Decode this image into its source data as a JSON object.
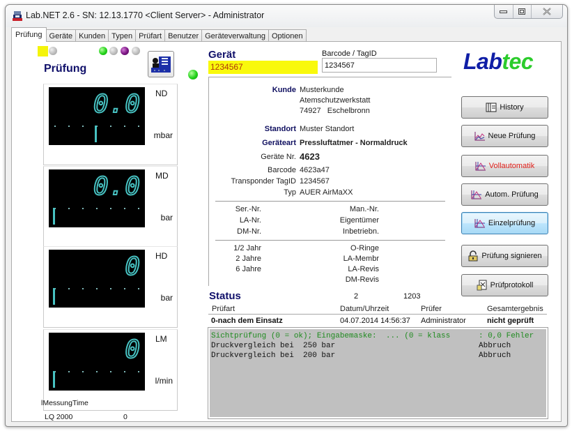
{
  "window": {
    "title": "Lab.NET 2.6 - SN: 12.13.1770 <Client Server> - Administrator",
    "controls": {
      "minimize": "minimize",
      "maximize": "maximize",
      "close": "close"
    }
  },
  "tabs": [
    {
      "label": "Prüfung",
      "active": true
    },
    {
      "label": "Geräte",
      "active": false
    },
    {
      "label": "Kunden",
      "active": false
    },
    {
      "label": "Typen",
      "active": false
    },
    {
      "label": "Prüfart",
      "active": false
    },
    {
      "label": "Benutzer",
      "active": false
    },
    {
      "label": "Geräteverwaltung",
      "active": false
    },
    {
      "label": "Optionen",
      "active": false
    }
  ],
  "left": {
    "heading": "Prüfung",
    "indicators": [
      "yellow",
      "gray",
      "green",
      "gray",
      "purple",
      "gray"
    ],
    "status_led": "green",
    "gauges": [
      {
        "name": "ND",
        "value": "0.0",
        "unit": "mbar",
        "needle_position": 0.5
      },
      {
        "name": "MD",
        "value": "0.0",
        "unit": "bar",
        "needle_position": 0
      },
      {
        "name": "HD",
        "value": "0",
        "unit": "bar",
        "needle_position": 0
      },
      {
        "name": "LM",
        "value": "0",
        "unit": "l/min",
        "needle_position": 0
      }
    ],
    "messung_time_label": "lMessungTime",
    "device_label": "LQ 2000",
    "device_value": "0"
  },
  "geraet": {
    "heading": "Gerät",
    "value": "1234567",
    "barcode_label": "Barcode / TagID",
    "barcode_value": "1234567"
  },
  "info": {
    "kunde_label": "Kunde",
    "kunde_lines": [
      "Musterkunde",
      "Atemschutzwerkstatt",
      "74927   Eschelbronn"
    ],
    "standort_label": "Standort",
    "standort": "Muster Standort",
    "geraeteart_label": "Geräteart",
    "geraeteart": "Pressluftatmer - Normaldruck",
    "geraete_nr_label": "Geräte Nr.",
    "geraete_nr": "4623",
    "barcode_label": "Barcode",
    "barcode": "4623a47",
    "transponder_label": "Transponder TagID",
    "transponder": "1234567",
    "typ_label": "Typ",
    "typ": "AUER AirMaXX",
    "group1_left": [
      "Ser.-Nr.",
      "LA-Nr.",
      "DM-Nr."
    ],
    "group1_right": [
      "Man.-Nr.",
      "Eigentümer",
      "Inbetriebn."
    ],
    "group2_left": [
      "1/2 Jahr",
      "2 Jahre",
      "6 Jahre"
    ],
    "group2_right": [
      "O-Ringe",
      "LA-Membr",
      "LA-Revis",
      "DM-Revis"
    ]
  },
  "logo": {
    "part1": "Lab",
    "part2": "tec"
  },
  "buttons": [
    {
      "label": "History",
      "icon": "history-icon"
    },
    {
      "label": "Neue Prüfung",
      "icon": "chart-icon"
    },
    {
      "label": "Vollautomatik",
      "icon": "chart-icon"
    },
    {
      "label": "Autom. Prüfung",
      "icon": "chart-icon"
    },
    {
      "label": "Einzelprüfung",
      "icon": "chart-icon"
    },
    {
      "label": "Prüfung signieren",
      "icon": "lock-icon"
    },
    {
      "label": "Prüfprotokoll",
      "icon": "protocol-icon"
    }
  ],
  "status": {
    "heading": "Status",
    "num1": "2",
    "num2": "1203",
    "columns": [
      "Prüfart",
      "Datum/Uhrzeit",
      "Prüfer",
      "Gesamtergebnis"
    ],
    "row": [
      "0-nach dem Einsatz",
      "04.07.2014 14:56:37",
      "Administrator",
      "nicht geprüft"
    ]
  },
  "log": [
    {
      "text": "Sichtprüfung (0 = ok); Eingabemaske:  ... (0 = klass ",
      "result": ": 0,0 Fehler",
      "color": "#1f8a1f"
    },
    {
      "text": "Druckvergleich bei  250 bar",
      "result": "Abbruch",
      "color": "#111111"
    },
    {
      "text": "Druckvergleich bei  200 bar",
      "result": "Abbruch",
      "color": "#111111"
    }
  ]
}
